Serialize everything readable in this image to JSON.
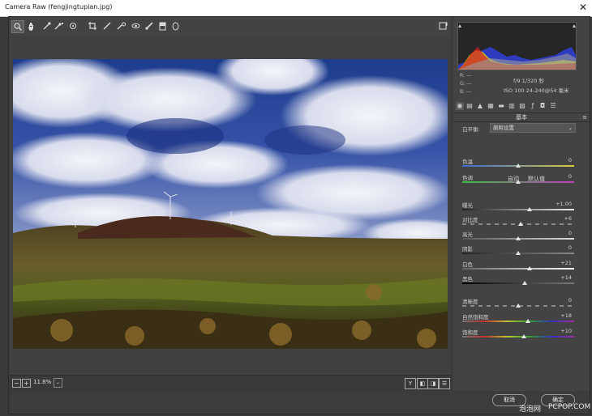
{
  "window": {
    "title": "Camera Raw (fengjingtupian.jpg)",
    "close": "✕"
  },
  "toolbar": {
    "tools": [
      "zoom-icon",
      "hand-icon",
      "white-balance-icon",
      "color-sampler-icon",
      "target-adjust-icon",
      "crop-icon",
      "straighten-icon",
      "spot-removal-icon",
      "red-eye-icon",
      "adjustment-brush-icon",
      "graduated-filter-icon",
      "radial-filter-icon"
    ],
    "fullscreen": "open-in-fullscreen-icon"
  },
  "status": {
    "zoom_out": "−",
    "zoom_in": "+",
    "zoom": "11.8%",
    "dropdown": "⌄",
    "views": [
      "Y",
      "◧",
      "◨",
      "☰"
    ]
  },
  "exif": {
    "r_label": "R:",
    "g_label": "G:",
    "b_label": "B:",
    "r": "---",
    "g": "---",
    "b": "---",
    "line1": "f/9  1/320 秒",
    "line2": "ISO 100  24-240@54 毫米"
  },
  "panel": {
    "section": "基本",
    "menu": "≡",
    "wb_label": "白平衡:",
    "wb_value": "原照设置",
    "auto": "自动",
    "default": "默认值"
  },
  "sliders": [
    {
      "key": "temp",
      "label": "色温",
      "value": "0",
      "pos": 0.5
    },
    {
      "key": "tint",
      "label": "色调",
      "value": "0",
      "pos": 0.5
    },
    {
      "key": "exposure",
      "label": "曝光",
      "value": "+1.00",
      "pos": 0.6
    },
    {
      "key": "contrast",
      "label": "对比度",
      "value": "+6",
      "pos": 0.52
    },
    {
      "key": "highlights",
      "label": "高光",
      "value": "0",
      "pos": 0.5
    },
    {
      "key": "shadows",
      "label": "阴影",
      "value": "0",
      "pos": 0.5
    },
    {
      "key": "whites",
      "label": "白色",
      "value": "+21",
      "pos": 0.6
    },
    {
      "key": "blacks",
      "label": "黑色",
      "value": "+14",
      "pos": 0.56
    },
    {
      "key": "clarity",
      "label": "清晰度",
      "value": "0",
      "pos": 0.5
    },
    {
      "key": "vibrance",
      "label": "自然饱和度",
      "value": "+18",
      "pos": 0.59
    },
    {
      "key": "saturation",
      "label": "饱和度",
      "value": "+10",
      "pos": 0.55
    }
  ],
  "buttons": {
    "cancel": "取消",
    "ok": "确定"
  },
  "watermark": {
    "left": "泡泡网",
    "right": "PCPOP.COM"
  }
}
